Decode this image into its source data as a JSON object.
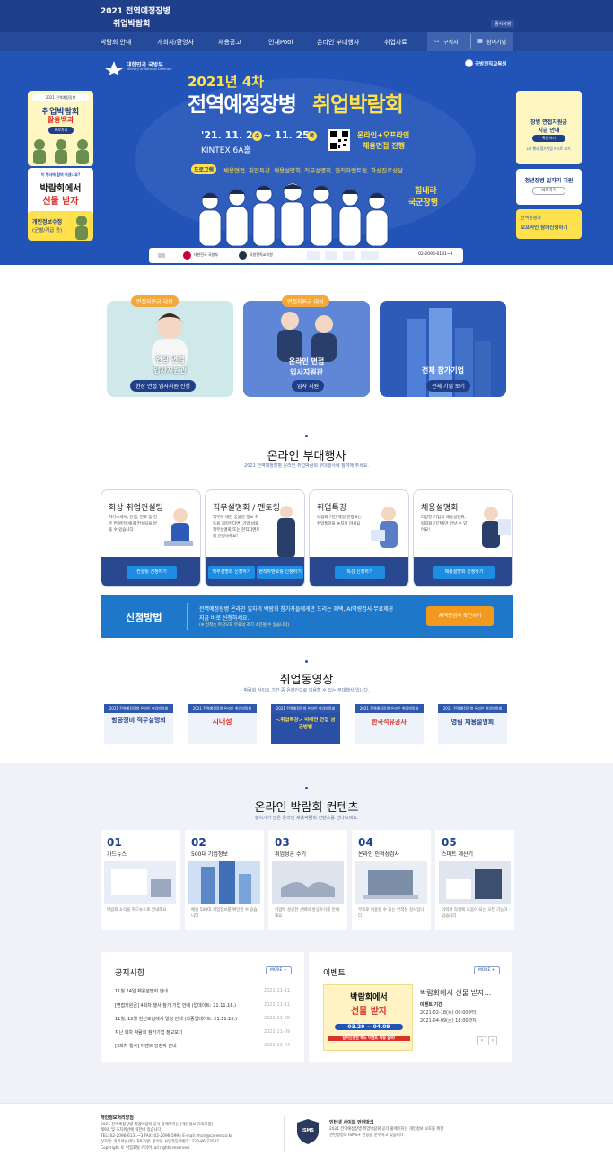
{
  "header": {
    "logo_line1": "2021 전역예정장병",
    "logo_line2": "취업박람회",
    "util_label": "공지사항"
  },
  "gnb": {
    "items": [
      "박람회 안내",
      "개최사/환영사",
      "채용공고",
      "인재Pool",
      "온라인 부대행사",
      "취업자료"
    ],
    "seeker": "구직자",
    "company": "참여기업"
  },
  "hero": {
    "mnd_name": "대한민국 국방부",
    "mnd_en": "Ministry of National Defense",
    "kidi_name": "국방전직교육원",
    "round": "2021년 4차",
    "title_a": "전역예정장병",
    "title_b": "취업박람회",
    "date": "'21. 11. 24 ~ 11. 25",
    "day1": "수",
    "day2": "목",
    "venue": "KINTEX 6A홀",
    "qr_line1": "온라인+오프라인",
    "qr_line2": "채용면접 진행",
    "program_tag": "프로그램",
    "program_text": "채용면접, 취업특강, 채용설명회, 직무설명회, 현직자멘토링, 화상진로상담",
    "slogan1": "힘내라",
    "slogan2": "국군장병",
    "sponsor_phone": "02-2096-6131~3",
    "left_banner1_top": "2021 전역예정장병",
    "left_banner1_title": "취업박람회",
    "left_banner1_sub": "활용백과",
    "left_banner1_btn": "바로가기",
    "left_banner2_top": "이 행사에 참여 하셨나요?",
    "left_banner2_line1": "박람회에서",
    "left_banner2_line2": "선물 받자",
    "left_banner3_line1": "개인정보수정",
    "left_banner3_line2": "(군별/계급 등)",
    "right_banner1_line1": "장병 면접지원금",
    "right_banner1_line2": "지급 안내",
    "right_banner1_btn": "확인하기",
    "right_banner1_sub": "4차 행사 참가기업 리스트 보기",
    "right_banner2_line1": "청년장병 일자리 지원",
    "right_banner2_btn": "바로가기",
    "right_banner3_line1": "전역장병과",
    "right_banner3_line2": "오프라인 참여신청하기"
  },
  "interview": {
    "cards": [
      {
        "badge": "면접지원금 대상",
        "title1": "현장 면접",
        "title2": "입사지원관",
        "btn": "현장 면접 입사지원 신청"
      },
      {
        "badge": "면접지원금 대상",
        "title1": "온라인 면접",
        "title2": "입사지원관",
        "btn": "입사 지원"
      },
      {
        "badge": "",
        "title1": "전체 참가기업",
        "title2": "",
        "btn": "전체 기업 보기"
      }
    ]
  },
  "online_events": {
    "title": "온라인 부대행사",
    "subtitle": "2021 전역예정장병 온라인 취업박람회 부대행사에 참여해 주세요.",
    "cards": [
      {
        "title": "화상 취업컨설팅",
        "desc": "자기소개서, 면접, 진로 등 전문 컨설턴트에게 컨설팅을 받을 수 있습니다",
        "btns": [
          "컨설팅 신청하기"
        ]
      },
      {
        "title": "직무설명회 / 멘토링",
        "desc": "직무에 대한 궁금한 정보 취득을 희망한다면, 기업 바로 직무설명회 또는 현직자멘토링 신청하세요!",
        "btns": [
          "직무설명회 신청하기",
          "현직자멘토링 신청하기"
        ]
      },
      {
        "title": "취업특강",
        "desc": "박람회 기간 매일 진행되는 취업특강을 놓치지 마세요",
        "btns": [
          "특강 신청하기"
        ]
      },
      {
        "title": "채용설명회",
        "desc": "다양한 기업의 채용설명회, 박람회 기간에만 만날 수 있어요!",
        "btns": [
          "채용설명회 신청하기"
        ]
      }
    ]
  },
  "apply": {
    "label": "신청방법",
    "text1": "전역예정장병 온라인 일자리 박람회 참가자들에게만 드리는 혜택, AI역량검사 무료제공",
    "text2": "지금 바로 신청하세요.",
    "note": "(※ 선착순 마감으로 무료의 조기 소진될 수 있습니다)",
    "btn": "AI역량검사 확인하기"
  },
  "videos": {
    "title": "취업동영상",
    "subtitle": "박람회 사이트 기간 중 온라인으로 이용할 수 있는 부대행사 입니다.",
    "items": [
      {
        "top": "2021 전역예정장병 온라인 취업박람회",
        "text": "항공정비 직무설명회"
      },
      {
        "top": "2021 전역예정장병 온라인 취업박람회",
        "text": "시대성"
      },
      {
        "top": "2021 전역예정장병 온라인 취업박람회",
        "text": "<취업특강> 비대면 면접 성공방법"
      },
      {
        "top": "2021 전역예정장병 온라인 취업박람회",
        "text": "한국석유공사"
      },
      {
        "top": "2021 전역예정장병 온라인 취업박람회",
        "text": "영림 채용설명회"
      }
    ]
  },
  "contents": {
    "title": "온라인 박람회 컨텐츠",
    "subtitle": "놓치기가 많은 온라인 채용박람회 컨텐츠를 만나보세요.",
    "items": [
      {
        "num": "01",
        "title": "카드뉴스",
        "desc": "박람회 소식을 카드뉴스로 안내해요"
      },
      {
        "num": "02",
        "title": "500대 기업정보",
        "desc": "매출 500대 기업정보를 확인할 수 있습니다"
      },
      {
        "num": "03",
        "title": "취업성공 수기",
        "desc": "취업에 성공한 선배의 성공수기를 안내해요"
      },
      {
        "num": "04",
        "title": "온라인 인적성검사",
        "desc": "무료로 이용할 수 있는 인적성 검사입니다"
      },
      {
        "num": "05",
        "title": "스마트 계산기",
        "desc": "이력서 작성에 도움이 되는 모든 기능이 있습니다"
      }
    ]
  },
  "notice": {
    "title": "공지사항",
    "more": "MORE +",
    "rows": [
      {
        "text": "11월 24일 채용설명회 안내",
        "date": "2021-11-11"
      },
      {
        "text": "[면접지원금] 4회차 행사 참가 기업 안내 (업데이트: 21.11.16.)",
        "date": "2021-11-11"
      },
      {
        "text": "11월, 12월 현신모집에서 일정 안내 (최종업데이트: 21.11.16.)",
        "date": "2021-11-09"
      },
      {
        "text": "지난 회차 박람회 참가기업 정보보기",
        "date": "2021-11-09"
      },
      {
        "text": "[3회차 행사] 이벤트 당첨자 안내",
        "date": "2021-11-04"
      }
    ]
  },
  "event": {
    "title": "이벤트",
    "more": "MORE +",
    "img_line1": "박람회에서",
    "img_line2": "선물 받자",
    "img_date": "03.29 ~ 04.09",
    "img_sub": "참가신청만 해도 이벤트 자동 참여!",
    "name": "박람회에서 선물 받자…",
    "period_label": "이벤트 기간",
    "start": "2021-02-18(목) 00:00부터",
    "end": "2021-04-09(금) 18:00까지"
  },
  "footer": {
    "col1_title": "개인정보처리방침",
    "col1_lines": [
      "2021 전역예정장병 취업박람회 공식 홈페이지는 [개인정보 처리지침]",
      "제9조 및 조치위반에 대한바 있습니다.",
      "TEL: 02-2096-6131~3 FAX: 02-2096-5994 E-mail: mcsl@career.co.kr",
      "상호명: 커리어넷(주) 대표자명: 강석용 사업자등록번호: 220-86-73547",
      "Copyright © 취업포털 커리어. all rights reserved."
    ],
    "col2_title": "인터넷 사이트 안전마크",
    "col2_lines": [
      "2021 전역예정장병 취업박람회 공식 홈페이지는 개인정보 보호를 위한",
      "관련법령의 ISMS+ 인증을 준수하고 있습니다."
    ],
    "isms": "ISMS"
  }
}
